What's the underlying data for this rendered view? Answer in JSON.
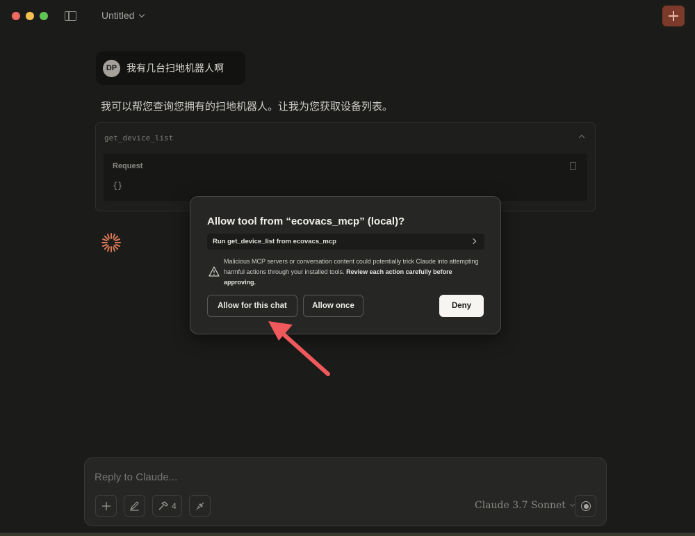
{
  "window": {
    "title": "Untitled"
  },
  "conversation": {
    "user_avatar_initials": "DP",
    "user_message": "我有几台扫地机器人啊",
    "assistant_message": "我可以帮您查询您拥有的扫地机器人。让我为您获取设备列表。",
    "tool_call": {
      "name": "get_device_list",
      "request_label": "Request",
      "request_body": "{}"
    }
  },
  "dialog": {
    "title": "Allow tool from “ecovacs_mcp” (local)?",
    "run_label": "Run get_device_list from ecovacs_mcp",
    "warning_text": "Malicious MCP servers or conversation content could potentially trick Claude into attempting harmful actions through your installed tools.",
    "warning_bold": "Review each action carefully before approving.",
    "allow_chat_label": "Allow for this chat",
    "allow_once_label": "Allow once",
    "deny_label": "Deny"
  },
  "composer": {
    "placeholder": "Reply to Claude...",
    "tools_count": "4",
    "model": "Claude 3.7 Sonnet"
  },
  "colors": {
    "accent": "#d97757",
    "annotation_arrow": "#f0595c",
    "new_chat_bg": "#7b3a2a"
  },
  "icons": [
    "sidebar-toggle-icon",
    "chevron-down-icon",
    "plus-icon",
    "chevron-up-icon",
    "copy-icon",
    "spinner-icon",
    "chevron-right-icon",
    "warning-icon",
    "pen-icon",
    "hammer-icon",
    "plug-icon",
    "record-icon"
  ]
}
